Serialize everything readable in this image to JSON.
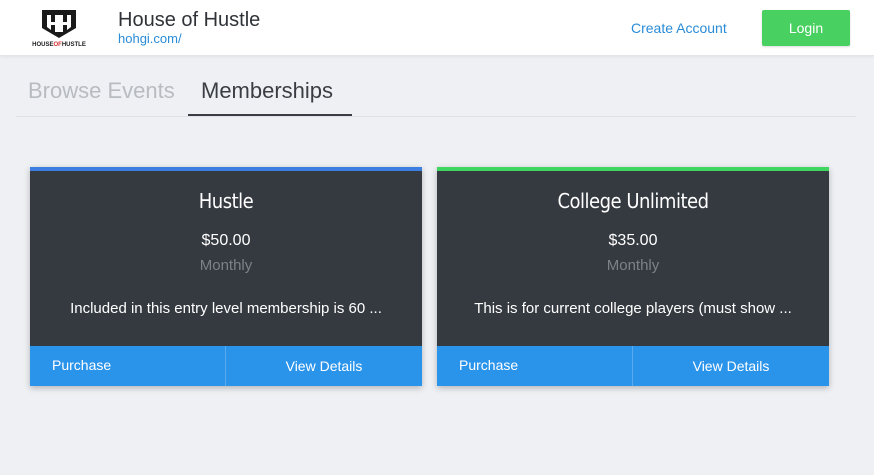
{
  "header": {
    "logo_text": "HOUSE OF HUSTLE",
    "title": "House of Hustle",
    "url": "hohgi.com/",
    "create_account_label": "Create Account",
    "login_label": "Login"
  },
  "tabs": [
    {
      "label": "Browse Events",
      "active": false
    },
    {
      "label": "Memberships",
      "active": true
    }
  ],
  "memberships": [
    {
      "name": "Hustle",
      "price": "$50.00",
      "period": "Monthly",
      "description": "Included in this entry level membership is 60 ...",
      "accent_color": "#3d7fe0",
      "purchase_label": "Purchase",
      "details_label": "View Details"
    },
    {
      "name": "College Unlimited",
      "price": "$35.00",
      "period": "Monthly",
      "description": "This is for current college players (must show ...",
      "accent_color": "#3ed65f",
      "purchase_label": "Purchase",
      "details_label": "View Details"
    }
  ],
  "colors": {
    "link": "#2a8bd6",
    "login_button": "#48d060",
    "card_bg": "#353940",
    "card_action_bar": "#2a93ea"
  }
}
